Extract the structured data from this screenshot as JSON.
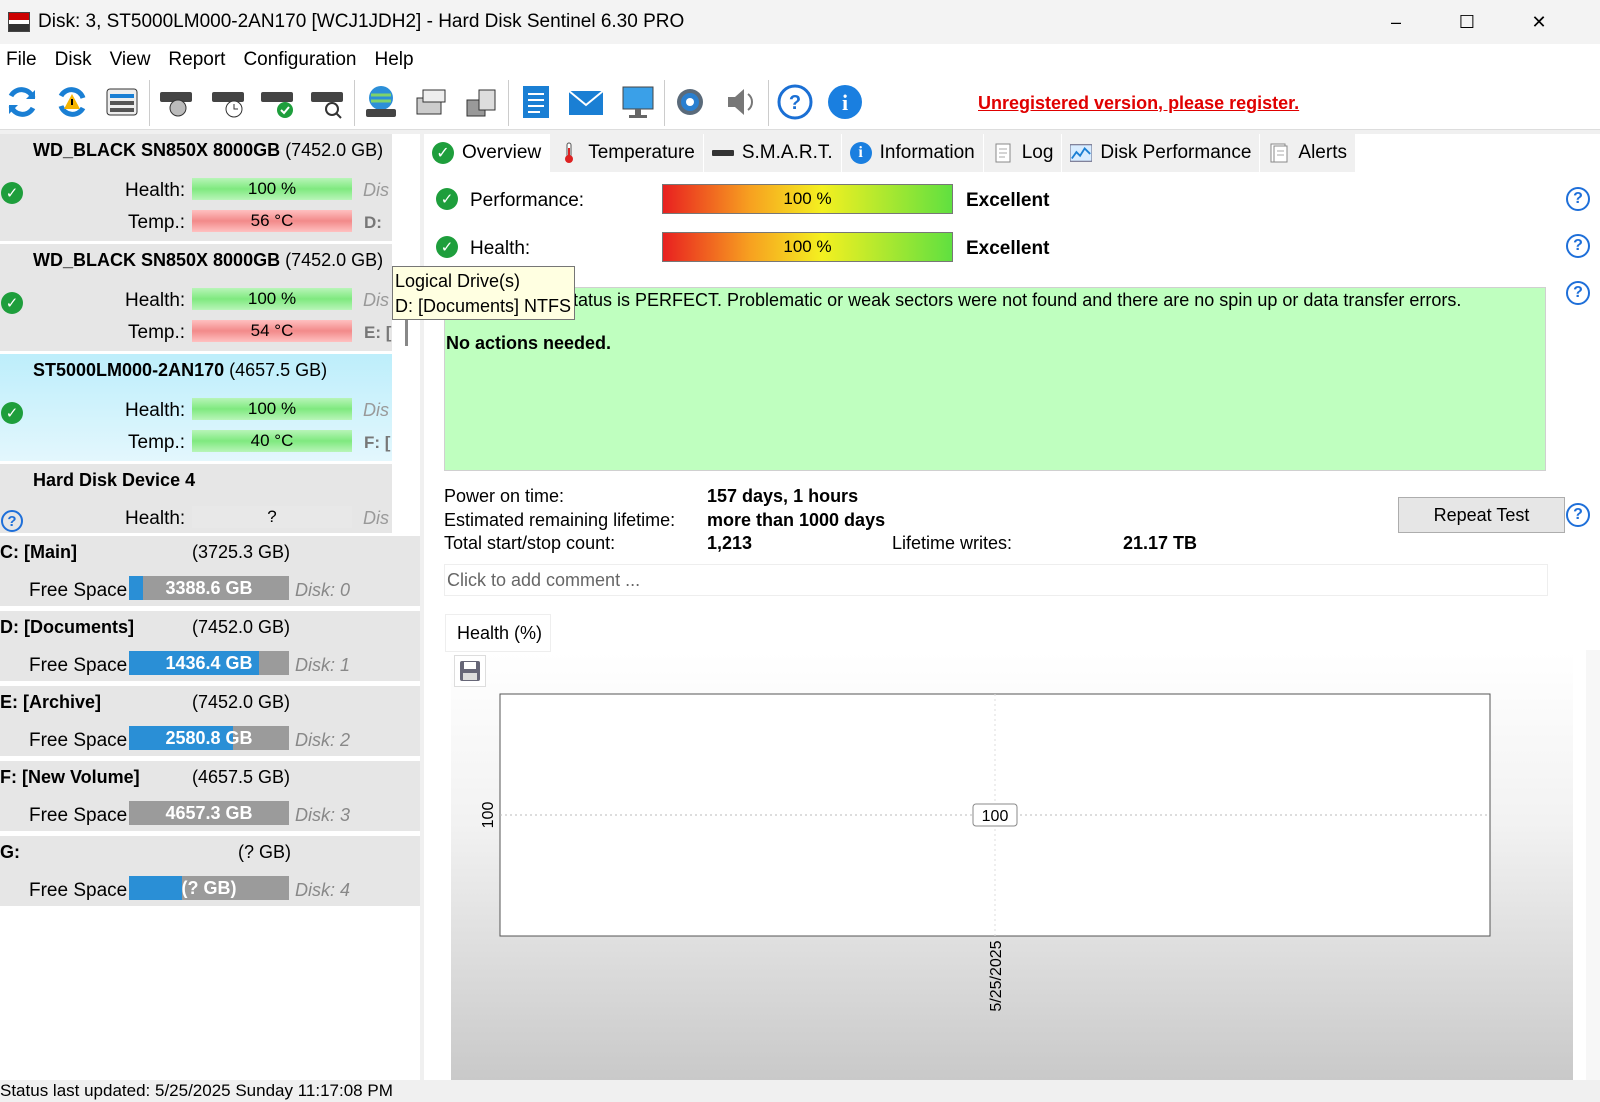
{
  "window": {
    "title": "Disk: 3, ST5000LM000-2AN170 [WCJ1JDH2]  -  Hard Disk Sentinel 6.30 PRO",
    "minimize": "–",
    "maximize": "☐",
    "close": "✕"
  },
  "menu": [
    "File",
    "Disk",
    "View",
    "Report",
    "Configuration",
    "Help"
  ],
  "toolbar": {
    "unregistered": "Unregistered version, please register."
  },
  "disks": [
    {
      "name": "WD_BLACK SN850X 8000GB",
      "size": "(7452.0 GB)",
      "health_label": "Health:",
      "health": "100 %",
      "temp_label": "Temp.:",
      "temp": "56 °C",
      "dis": "Dis",
      "drive": "D:",
      "status": "ok"
    },
    {
      "name": "WD_BLACK SN850X 8000GB",
      "size": "(7452.0 GB)",
      "health_label": "Health:",
      "health": "100 %",
      "temp_label": "Temp.:",
      "temp": "54 °C",
      "dis": "Dis",
      "drive": "E: [",
      "status": "ok"
    },
    {
      "name": "ST5000LM000-2AN170",
      "size": "(4657.5 GB)",
      "health_label": "Health:",
      "health": "100 %",
      "temp_label": "Temp.:",
      "temp": "40 °C",
      "dis": "Dis",
      "drive": "F: [",
      "status": "ok"
    },
    {
      "name": "Hard Disk Device 4",
      "size": "",
      "health_label": "Health:",
      "health": "?",
      "dis": "Dis",
      "status": "unknown"
    }
  ],
  "volumes": [
    {
      "name": "C: [Main]",
      "size": "(3725.3 GB)",
      "free_label": "Free Space",
      "free": "3388.6 GB",
      "disk": "Disk: 0",
      "used_fraction": 0.09
    },
    {
      "name": "D: [Documents]",
      "size": "(7452.0 GB)",
      "free_label": "Free Space",
      "free": "1436.4 GB",
      "disk": "Disk: 1",
      "used_fraction": 0.81
    },
    {
      "name": "E: [Archive]",
      "size": "(7452.0 GB)",
      "free_label": "Free Space",
      "free": "2580.8 GB",
      "disk": "Disk: 2",
      "used_fraction": 0.65
    },
    {
      "name": "F: [New Volume]",
      "size": "(4657.5 GB)",
      "free_label": "Free Space",
      "free": "4657.3 GB",
      "disk": "Disk: 3",
      "used_fraction": 0.0
    },
    {
      "name": "G:",
      "size": "(? GB)",
      "free_label": "Free Space",
      "free": "(? GB)",
      "disk": "Disk: 4",
      "used_fraction": 0.33
    }
  ],
  "tooltip": {
    "line1": "Logical Drive(s)",
    "line2": "D: [Documents] NTFS"
  },
  "tabs": [
    "Overview",
    "Temperature",
    "S.M.A.R.T.",
    "Information",
    "Log",
    "Disk Performance",
    "Alerts"
  ],
  "overview": {
    "performance_label": "Performance:",
    "performance_value": "100 %",
    "performance_rating": "Excellent",
    "health_label": "Health:",
    "health_value": "100 %",
    "health_rating": "Excellent",
    "status_text": "tatus is PERFECT. Problematic or weak sectors were not found and there are no spin up or data transfer errors.",
    "actions": "No actions needed.",
    "power_on_label": "Power on time:",
    "power_on_value": "157 days, 1 hours",
    "lifetime_label": "Estimated remaining lifetime:",
    "lifetime_value": "more than 1000 days",
    "startstop_label": "Total start/stop count:",
    "startstop_value": "1,213",
    "writes_label": "Lifetime writes:",
    "writes_value": "21.17 TB",
    "repeat_test": "Repeat Test",
    "comment_placeholder": "Click to add comment ..."
  },
  "chart_tab": "Health (%)",
  "chart_data": {
    "type": "line",
    "x": [
      "5/25/2025"
    ],
    "values": [
      100
    ],
    "ytick": "100",
    "data_label": "100",
    "grid": true
  },
  "statusbar": "Status last updated: 5/25/2025 Sunday 11:17:08 PM"
}
